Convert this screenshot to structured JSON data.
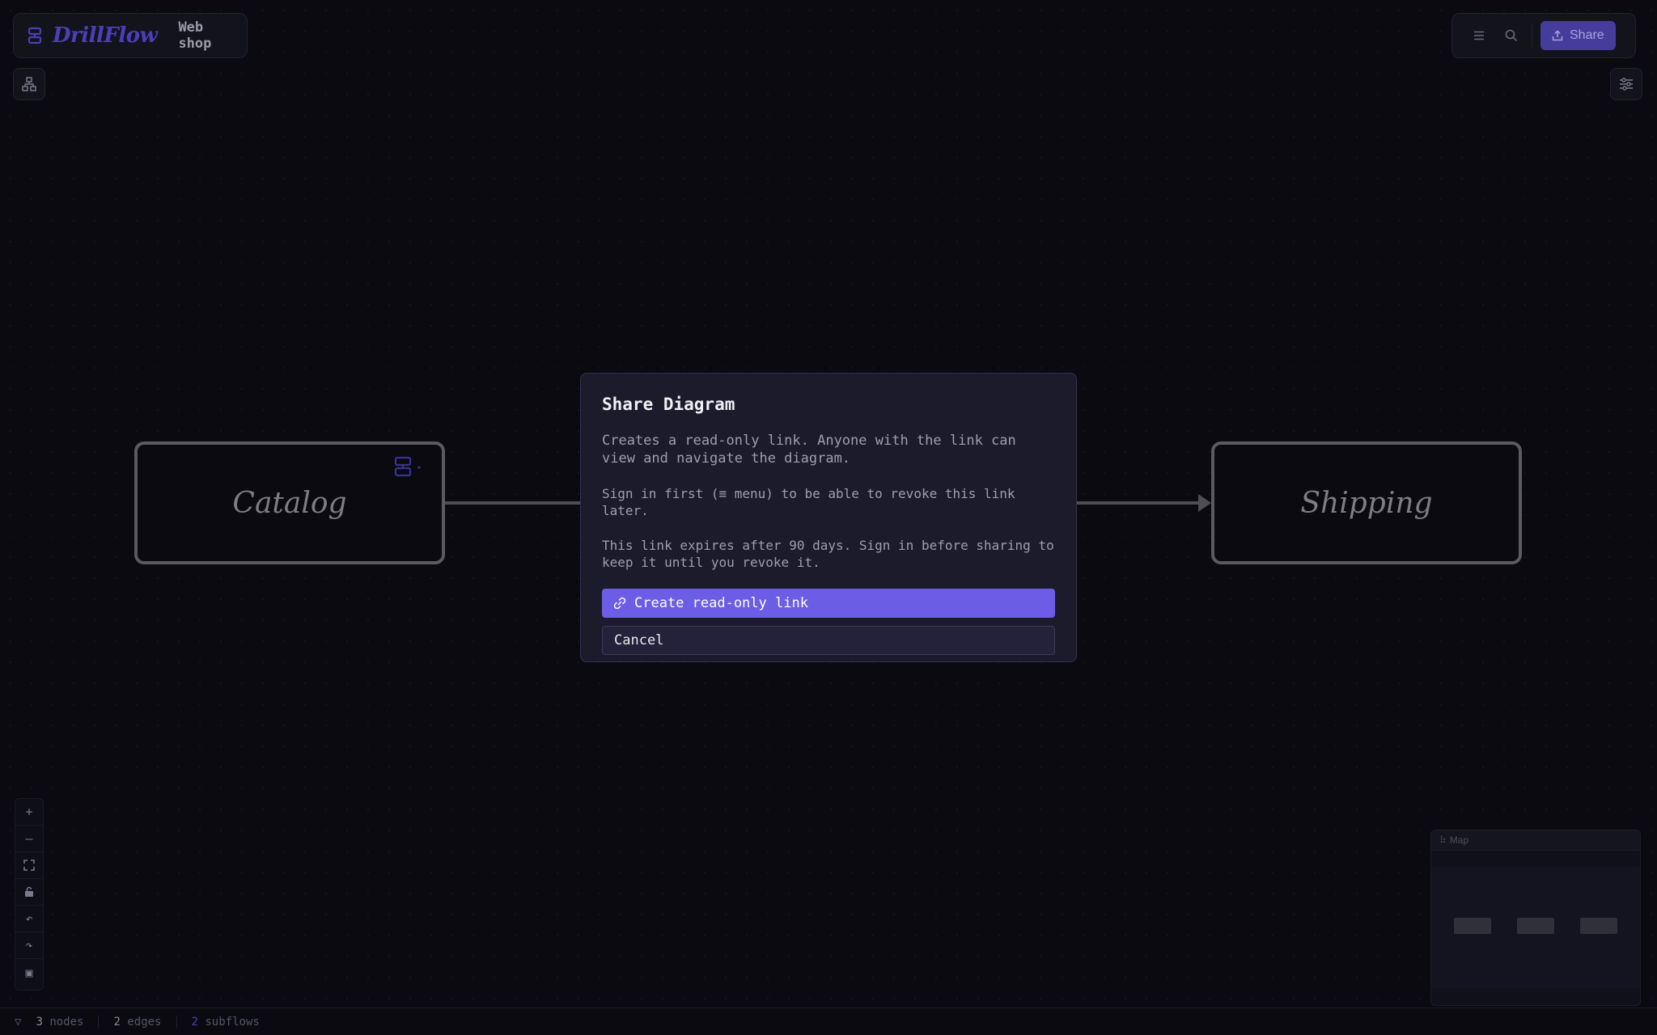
{
  "app": {
    "name": "DrillFlow",
    "diagram_name": "Web shop"
  },
  "toolbar": {
    "menu_icon": "hamburger-icon",
    "search_icon": "search-icon",
    "share_label": "Share"
  },
  "canvas": {
    "nodes": [
      {
        "label": "Catalog",
        "has_subflow": true
      },
      {
        "label": "Shipping",
        "has_subflow": false
      }
    ]
  },
  "modal": {
    "title": "Share Diagram",
    "description": "Creates a read-only link. Anyone with the link can view and navigate the diagram.",
    "note_signin": "Sign in first (≡ menu) to be able to revoke this link later.",
    "note_expiry": "This link expires after 90 days. Sign in before sharing to keep it until you revoke it.",
    "primary_label": "Create read-only link",
    "cancel_label": "Cancel"
  },
  "controls": {
    "zoom_in": "+",
    "zoom_out": "—",
    "fit_icon": "fit-view-icon",
    "lock_icon": "lock-icon",
    "undo": "↶",
    "redo": "↷",
    "frame": "▣"
  },
  "minimap": {
    "title": "Map",
    "grip": "⠷"
  },
  "status": {
    "filter_icon": "▽",
    "nodes_count": "3",
    "nodes_label": "nodes",
    "edges_count": "2",
    "edges_label": "edges",
    "subflows_count": "2",
    "subflows_label": "subflows"
  }
}
